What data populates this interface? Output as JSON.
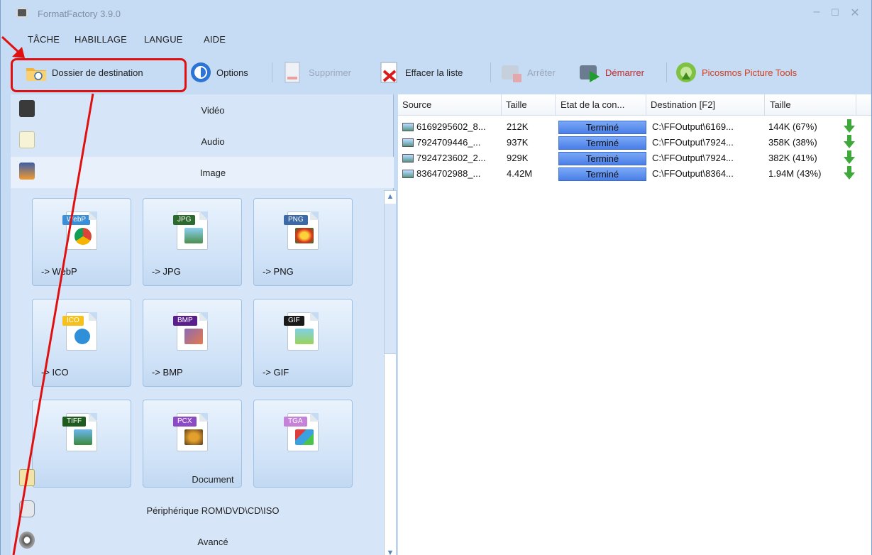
{
  "window": {
    "title": "FormatFactory 3.9.0"
  },
  "menu": [
    "TÂCHE",
    "HABILLAGE",
    "LANGUE",
    "AIDE"
  ],
  "toolbar": {
    "dest": "Dossier de destination",
    "options": "Options",
    "delete": "Supprimer",
    "clear": "Effacer la liste",
    "stop": "Arrêter",
    "start": "Démarrer",
    "picosmos": "Picosmos Picture Tools"
  },
  "categories": {
    "video": "Vidéo",
    "audio": "Audio",
    "image": "Image",
    "document": "Document",
    "rom": "Périphérique ROM\\DVD\\CD\\ISO",
    "advanced": "Avancé"
  },
  "tiles": [
    {
      "tag": "WebP",
      "label": "-> WebP"
    },
    {
      "tag": "JPG",
      "label": "-> JPG"
    },
    {
      "tag": "PNG",
      "label": "-> PNG"
    },
    {
      "tag": "ICO",
      "label": "-> ICO"
    },
    {
      "tag": "BMP",
      "label": "-> BMP"
    },
    {
      "tag": "GIF",
      "label": "-> GIF"
    },
    {
      "tag": "TIFF",
      "label": ""
    },
    {
      "tag": "PCX",
      "label": ""
    },
    {
      "tag": "TGA",
      "label": ""
    }
  ],
  "table": {
    "headers": [
      "Source",
      "Taille",
      "Etat de la con...",
      "Destination [F2]",
      "Taille"
    ],
    "rows": [
      {
        "source": "6169295602_8...",
        "size": "212K",
        "status": "Terminé",
        "dest": "C:\\FFOutput\\6169...",
        "outsize": "144K (67%)"
      },
      {
        "source": "7924709446_...",
        "size": "937K",
        "status": "Terminé",
        "dest": "C:\\FFOutput\\7924...",
        "outsize": "358K (38%)"
      },
      {
        "source": "7924723602_2...",
        "size": "929K",
        "status": "Terminé",
        "dest": "C:\\FFOutput\\7924...",
        "outsize": "382K (41%)"
      },
      {
        "source": "8364702988_...",
        "size": "4.42M",
        "status": "Terminé",
        "dest": "C:\\FFOutput\\8364...",
        "outsize": "1.94M (43%)"
      }
    ]
  },
  "colors": {
    "accent_red": "#e01010",
    "status_blue": "#4a7ee8",
    "window_bg": "#c6dcf4"
  }
}
